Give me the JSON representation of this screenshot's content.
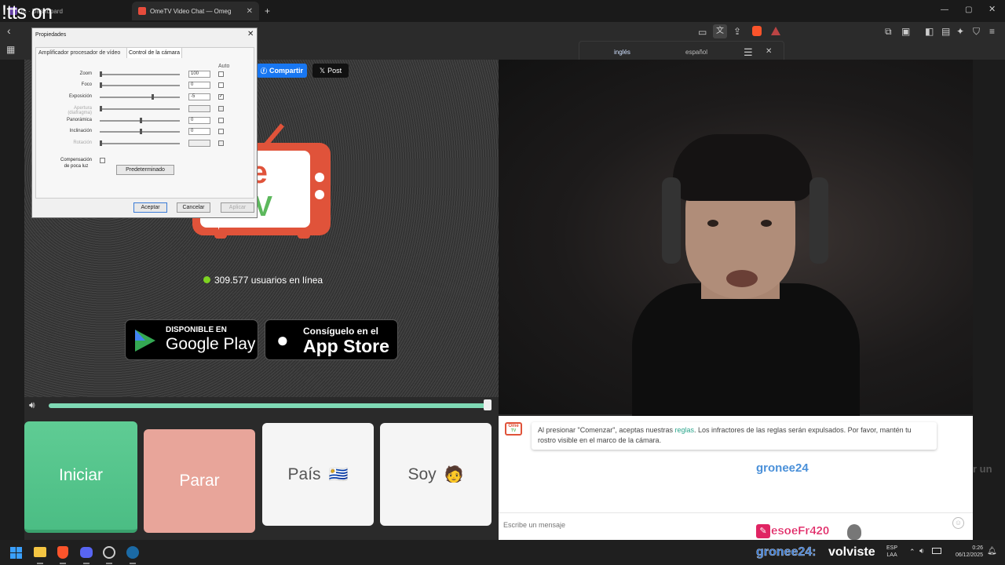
{
  "browser": {
    "tabs": [
      {
        "label": "m · Dashboard"
      },
      {
        "label": "OmeTV Video Chat — Omeg"
      }
    ]
  },
  "overlay": {
    "top_left_text": "!tts on"
  },
  "translate_bar": {
    "lang_from": "inglés",
    "lang_to": "español"
  },
  "share": {
    "facebook": "Compartir",
    "x": "Post"
  },
  "logo": {
    "text_top": "me",
    "text_bottom": "V"
  },
  "online": {
    "text": "309.577 usuarios en línea",
    "dot_color": "#7ed321"
  },
  "stores": {
    "google_small": "DISPONIBLE EN",
    "google_big": "Google Play",
    "apple_small": "Consíguelo en el",
    "apple_big": "App Store"
  },
  "volume": {
    "level": 1.0
  },
  "buttons": {
    "start": "Iniciar",
    "stop": "Parar",
    "country": "País",
    "country_flag": "🇺🇾",
    "gender": "Soy",
    "gender_emoji": "🧑"
  },
  "chat": {
    "logo_top": "Ome",
    "logo_bottom": "TV",
    "notice_pre": "Al presionar \"Comenzar\", aceptas nuestras ",
    "notice_link": "reglas",
    "notice_post": ". Los infractores de las reglas serán expulsados. Por favor, mantén tu rostro visible en el marco de la cámara.",
    "placeholder": "Escribe un mensaje",
    "username_overlay": "gronee24"
  },
  "stream_overlay": {
    "side_text": "r un",
    "donor": "esoeFr420",
    "chat_user": "gronee24:",
    "chat_msg": "volviste"
  },
  "dialog": {
    "title": "Propiedades",
    "tabs": [
      "Amplificador procesador de vídeo",
      "Control de la cámara"
    ],
    "auto_header": "Auto",
    "rows": [
      {
        "label": "Zoom",
        "value": "100",
        "checked": false,
        "disabled": false,
        "pos": 0.0
      },
      {
        "label": "Foco",
        "value": "0",
        "checked": false,
        "disabled": false,
        "pos": 0.0
      },
      {
        "label": "Exposición",
        "value": "-5",
        "checked": true,
        "disabled": false,
        "pos": 0.65
      },
      {
        "label": "Apertura\n(diafragma)",
        "value": "",
        "checked": false,
        "disabled": true,
        "pos": 0.0
      },
      {
        "label": "Panorámica",
        "value": "0",
        "checked": false,
        "disabled": false,
        "pos": 0.5
      },
      {
        "label": "Inclinación",
        "value": "0",
        "checked": false,
        "disabled": false,
        "pos": 0.5
      },
      {
        "label": "Rotación",
        "value": "",
        "checked": false,
        "disabled": true,
        "pos": 0.0
      }
    ],
    "lowlight_label": "Compensación\nde poca luz",
    "default_btn": "Predeterminado",
    "ok": "Aceptar",
    "cancel": "Cancelar",
    "apply": "Aplicar"
  },
  "taskbar": {
    "lang_top": "ESP",
    "lang_bottom": "LAA",
    "time": "0:26",
    "date": "06/12/2025"
  }
}
